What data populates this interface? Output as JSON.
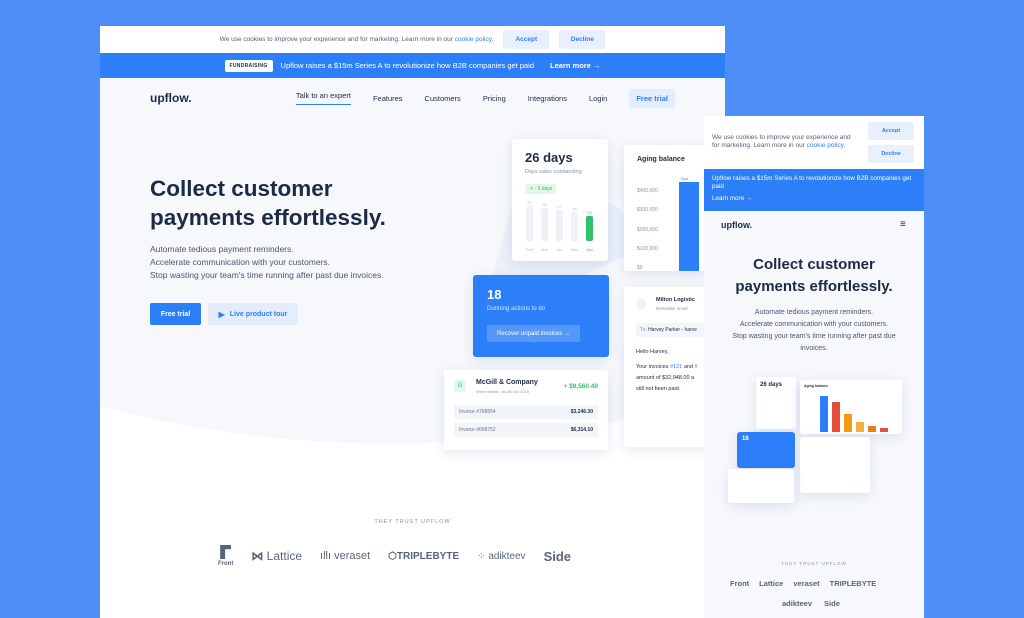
{
  "desktop": {
    "cookie": {
      "text": "We use cookies to improve your experience and for marketing. Learn more in our",
      "link": "cookie policy.",
      "accept": "Accept",
      "decline": "Decline"
    },
    "banner": {
      "tag": "FUNDRAISING",
      "text": "Upflow raises a $15m Series A to revolutionize how B2B companies get paid",
      "link": "Learn more →"
    },
    "nav": {
      "logo": "upflow.",
      "links": [
        "Talk to an expert",
        "Features",
        "Customers",
        "Pricing",
        "Integrations",
        "Login"
      ],
      "cta": "Free trial"
    },
    "hero": {
      "title_line1": "Collect customer",
      "title_line2": "payments effortlessly.",
      "sub1": "Automate tedious payment reminders.",
      "sub2": "Accelerate communication with your customers.",
      "sub3": "Stop wasting your team's time running after past due invoices.",
      "cta_primary": "Free trial",
      "cta_secondary": "Live product tour"
    },
    "dso_card": {
      "value": "26 days",
      "label": "Days sales outstanding",
      "badge": "↗ - 9 days",
      "months": [
        "Feb",
        "Mar",
        "Apr",
        "May",
        "Jun"
      ],
      "bar_values": [
        31,
        29,
        27,
        25,
        22
      ]
    },
    "aging_card": {
      "title": "Aging balance",
      "ticks": [
        "$400,000",
        "$300,000",
        "$200,000",
        "$100,000",
        "$0"
      ],
      "bar_label": "Due"
    },
    "actions_card": {
      "count": "18",
      "label": "Dunning actions to do",
      "button": "Recover unpaid invoices →"
    },
    "email_card": {
      "company": "Milton Logistic",
      "meta": "Reminder email",
      "to_label": "To:",
      "to": "Harvey Parker - harve",
      "greeting": "Hello Harvey,",
      "line1a": "Your invoices ",
      "inv1": "#121",
      "line1b": " and ",
      "inv2": "#",
      "line2": "amount of $32,948.00 a",
      "line3": "still not been paid."
    },
    "payment_card": {
      "company": "McGill & Company",
      "meta": "Wire transfer, Jul 28 Oct 2019",
      "amount": "+ $9,560.40",
      "invoices": [
        {
          "id": "Invoice #768554",
          "amount": "$3,246.30"
        },
        {
          "id": "Invoice #698752",
          "amount": "$6,314.10"
        }
      ]
    },
    "trust": {
      "title": "THEY TRUST UPFLOW",
      "logos": [
        "Front",
        "Lattice",
        "veraset",
        "TRIPLEBYTE",
        "adikteev",
        "Side"
      ]
    }
  },
  "mobile": {
    "cookie": {
      "text": "We use cookies to improve your experience and for marketing. Learn more in our",
      "link": "cookie policy.",
      "accept": "Accept",
      "decline": "Decline"
    },
    "banner": {
      "text": "Upflow raises a $15m Series A to revolutionize how B2B companies get paid",
      "link": "Learn more →"
    },
    "logo": "upflow.",
    "title_line1": "Collect customer",
    "title_line2": "payments effortlessly.",
    "sub1": "Automate tedious payment reminders.",
    "sub2": "Accelerate communication with your customers.",
    "sub3": "Stop wasting your team's time running after past due",
    "sub4": "invoices.",
    "mini": {
      "dso": "26 days",
      "aging": "Aging balance",
      "actions": "18"
    },
    "trust": {
      "title": "THEY TRUST UPFLOW",
      "logos": [
        "Front",
        "Lattice",
        "veraset",
        "TRIPLEBYTE",
        "adikteev",
        "Side"
      ]
    }
  },
  "colors": {
    "background": "#4d8ef7",
    "accent": "#2d7ff9",
    "positive": "#2ec26a",
    "text": "#1d2a44"
  }
}
